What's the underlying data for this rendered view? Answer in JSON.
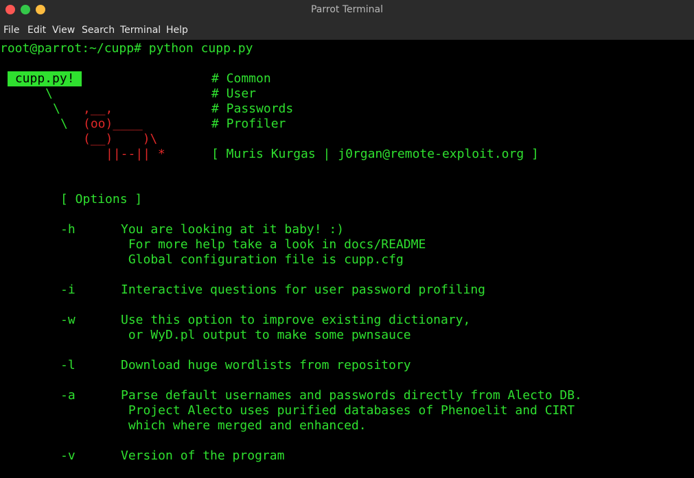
{
  "window": {
    "title": "Parrot Terminal"
  },
  "menu": {
    "file": "File",
    "edit": "Edit",
    "view": "View",
    "search": "Search",
    "terminal": "Terminal",
    "help": "Help"
  },
  "terminal": {
    "prompt_line": "root@parrot:~/cupp# python cupp.py",
    "banner": {
      "label": " cupp.py! ",
      "slash1": "\\",
      "slash2": "\\",
      "slash3": "\\",
      "cow_head": ",__,",
      "cow_eyes": "(oo)____",
      "cow_body": "(__)    )\\",
      "cow_legs": "||--|| *",
      "menu_common": "# Common",
      "menu_user": "# User",
      "menu_passwords": "# Passwords",
      "menu_profiler": "# Profiler",
      "credits": "[ Muris Kurgas | j0rgan@remote-exploit.org ]"
    },
    "options_header": "[ Options ]",
    "options": {
      "h_flag": "-h",
      "h_desc1": "You are looking at it baby! :)",
      "h_desc2": " For more help take a look in docs/README",
      "h_desc3": " Global configuration file is cupp.cfg",
      "i_flag": "-i",
      "i_desc1": "Interactive questions for user password profiling",
      "w_flag": "-w",
      "w_desc1": "Use this option to improve existing dictionary,",
      "w_desc2": " or WyD.pl output to make some pwnsauce",
      "l_flag": "-l",
      "l_desc1": "Download huge wordlists from repository",
      "a_flag": "-a",
      "a_desc1": "Parse default usernames and passwords directly from Alecto DB.",
      "a_desc2": " Project Alecto uses purified databases of Phenoelit and CIRT",
      "a_desc3": " which where merged and enhanced.",
      "v_flag": "-v",
      "v_desc1": "Version of the program"
    }
  },
  "colors": {
    "text": "#2fe02f",
    "cow": "#e02828",
    "background": "#000000",
    "chrome": "#2b2b2b"
  }
}
